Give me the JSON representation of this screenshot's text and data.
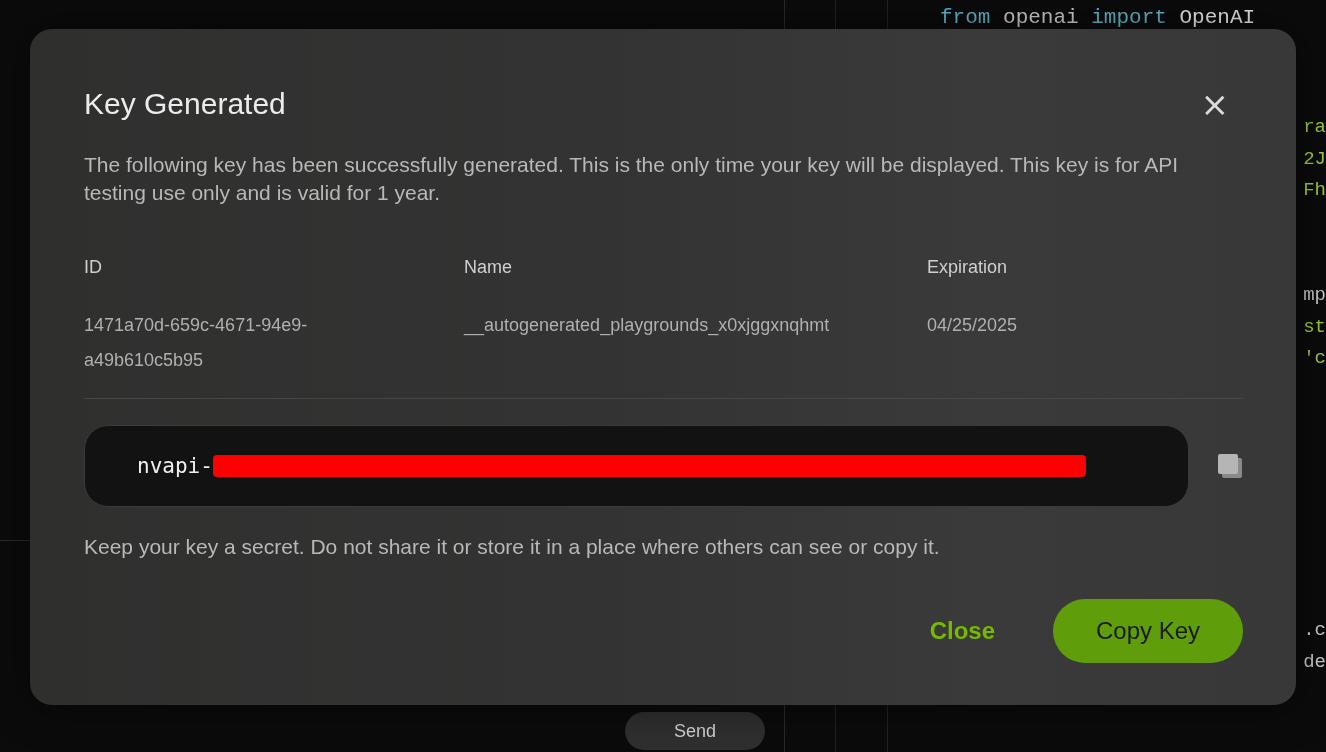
{
  "code_panel": {
    "first_line": [
      {
        "text": "from",
        "kind": "keyword"
      },
      {
        "text": " openai ",
        "kind": "plain"
      },
      {
        "text": "import",
        "kind": "keyword"
      },
      {
        "text": " OpenAI",
        "kind": "name"
      }
    ],
    "fragment_groups": [
      [
        {
          "text": "ra",
          "kind": "string"
        },
        {
          "text": "2J",
          "kind": "string"
        },
        {
          "text": "Fh",
          "kind": "string"
        }
      ],
      [
        {
          "text": "mp",
          "kind": "plain"
        },
        {
          "text": "st",
          "kind": "string"
        },
        {
          "text": "'c",
          "kind": "string"
        }
      ],
      [
        {
          "text": ".c",
          "kind": "plain"
        },
        {
          "text": "de",
          "kind": "plain"
        }
      ]
    ]
  },
  "chat": {
    "send_button": "Send"
  },
  "dialog": {
    "title": "Key Generated",
    "close_icon": "×",
    "description": "The following key has been successfully generated. This is the only time your key will be displayed. This key is for API testing use only and is valid for 1 year.",
    "table": {
      "columns": [
        "ID",
        "Name",
        "Expiration"
      ],
      "row": [
        "1471a70d-659c-4671-94e9-a49b610c5b95",
        "__autogenerated_playgrounds_x0xjggxnqhmt",
        "04/25/2025"
      ]
    },
    "key_prefix": "nvapi-",
    "note": "Keep your key a secret. Do not share it or store it in a place where others can see or copy it.",
    "buttons": [
      {
        "label": "Close",
        "kind": "text"
      },
      {
        "label": "Copy Key",
        "kind": "primary"
      }
    ]
  }
}
